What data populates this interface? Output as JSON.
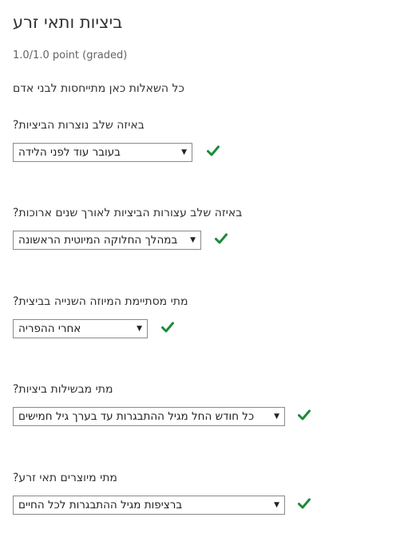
{
  "problem": {
    "title": "ביציות ותאי זרע",
    "points": "1.0/1.0 point (graded)",
    "intro": "כל השאלות כאן מתייחסות לבני אדם"
  },
  "questions": [
    {
      "text": "באיזה שלב נוצרות הביציות?",
      "selected": "בעובר עוד לפני הלידה",
      "status": "correct"
    },
    {
      "text": "באיזה שלב עצורות הביציות לאורך שנים ארוכות?",
      "selected": "במהלך החלוקה המיוטית הראשונה",
      "status": "correct"
    },
    {
      "text": "מתי מסתיימת המיוזה השנייה בביצית?",
      "selected": "אחרי ההפריה",
      "status": "correct"
    },
    {
      "text": "מתי מבשילות ביציות?",
      "selected": "כל חודש החל מגיל ההתבגרות עד בערך גיל חמישים",
      "status": "correct"
    },
    {
      "text": "מתי מיוצרים תאי זרע?",
      "selected": "ברציפות מגיל ההתבגרות לכל החיים",
      "status": "correct"
    }
  ],
  "colors": {
    "check": "#1c8b3a",
    "border": "#8a8a8a",
    "text": "#313131"
  },
  "icons": {
    "dropdown": "chevron-down-icon",
    "status": "checkmark-icon"
  }
}
